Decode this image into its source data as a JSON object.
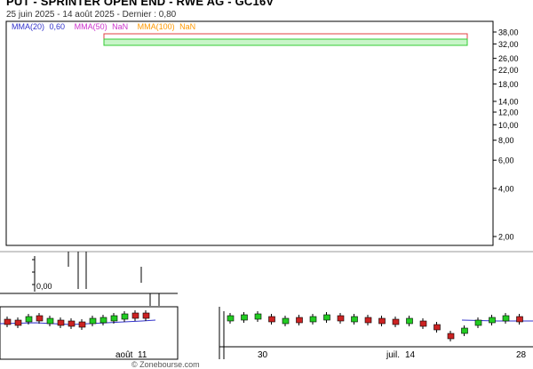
{
  "header": {
    "title": "PUT - SPRINTER OPEN END - RWE AG - GC16V",
    "subtitle": "25 juin 2025 - 14 août 2025 - Dernier : 0,80"
  },
  "legend": {
    "mma20_label": "MMA(20)",
    "mma20_value": "0,60",
    "mma50_label": "MMA(50)",
    "mma50_value": "NaN",
    "mma100_label": "MMA(100)",
    "mma100_value": "NaN"
  },
  "colors": {
    "mma20": "#3333cc",
    "mma50": "#cc33cc",
    "mma100": "#ff9900",
    "up_candle": "#22cc22",
    "down_candle": "#cc2222"
  },
  "chart_data": {
    "type": "candlestick",
    "y_axis": {
      "scale": "log",
      "ticks": [
        "38,00",
        "32,00",
        "26,00",
        "22,00",
        "18,00",
        "14,00",
        "12,00",
        "10,00",
        "8,00",
        "6,00",
        "4,00",
        "2,00"
      ]
    },
    "x_axis": {
      "labels_left": [
        "août",
        "11"
      ],
      "labels_right": [
        "30",
        "juil.",
        "14",
        "28"
      ]
    },
    "overlay_axis_label": "0,00",
    "zones": [
      {
        "color": "red",
        "label": ""
      },
      {
        "color": "green",
        "label": ""
      }
    ],
    "candles_left": [
      {
        "dir": "down"
      },
      {
        "dir": "down"
      },
      {
        "dir": "up"
      },
      {
        "dir": "down"
      },
      {
        "dir": "up"
      },
      {
        "dir": "down"
      },
      {
        "dir": "down"
      },
      {
        "dir": "down"
      },
      {
        "dir": "up"
      },
      {
        "dir": "up"
      },
      {
        "dir": "up"
      },
      {
        "dir": "up"
      },
      {
        "dir": "down"
      },
      {
        "dir": "down"
      }
    ],
    "candles_right": [
      {
        "dir": "up"
      },
      {
        "dir": "up"
      },
      {
        "dir": "up"
      },
      {
        "dir": "down"
      },
      {
        "dir": "up"
      },
      {
        "dir": "down"
      },
      {
        "dir": "up"
      },
      {
        "dir": "up"
      },
      {
        "dir": "down"
      },
      {
        "dir": "up"
      },
      {
        "dir": "down"
      },
      {
        "dir": "down"
      },
      {
        "dir": "down"
      },
      {
        "dir": "up"
      },
      {
        "dir": "down"
      },
      {
        "dir": "down"
      },
      {
        "dir": "down"
      },
      {
        "dir": "up"
      },
      {
        "dir": "up"
      },
      {
        "dir": "up"
      },
      {
        "dir": "up"
      },
      {
        "dir": "down"
      }
    ]
  },
  "footer": {
    "watermark": "© Zonebourse.com"
  }
}
